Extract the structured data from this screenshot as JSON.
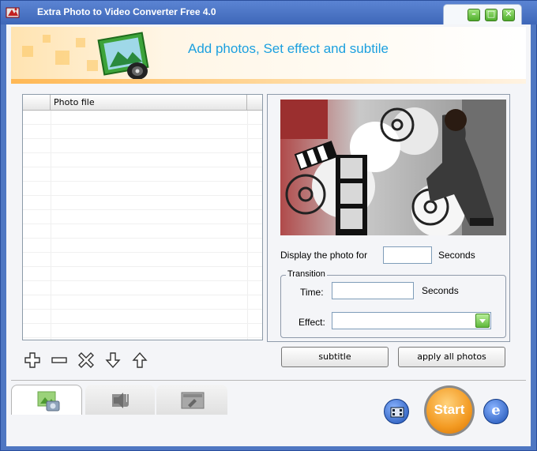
{
  "window": {
    "title": "Extra Photo to Video Converter Free 4.0"
  },
  "banner": {
    "headline": "Add photos, Set effect and subtile"
  },
  "photo_list": {
    "column_header": "Photo file",
    "rows": []
  },
  "settings": {
    "display_label": "Display the photo for",
    "display_value": "",
    "display_unit": "Seconds",
    "transition_legend": "Transition",
    "time_label": "Time:",
    "time_value": "",
    "time_unit": "Seconds",
    "effect_label": "Effect:",
    "effect_value": ""
  },
  "buttons": {
    "subtitle": "subtitle",
    "apply_all": "apply all photos",
    "start": "Start"
  },
  "toolbar": [
    "add-icon",
    "remove-icon",
    "clear-icon",
    "move-down-icon",
    "move-up-icon"
  ],
  "tabs": [
    "photo-tab-icon",
    "audio-tab-icon",
    "video-settings-tab-icon"
  ],
  "colors": {
    "accent": "#1ca0df",
    "title_bar": "#4f77c2",
    "start_button": "#f39a22",
    "ok_green": "#5fb83b"
  }
}
